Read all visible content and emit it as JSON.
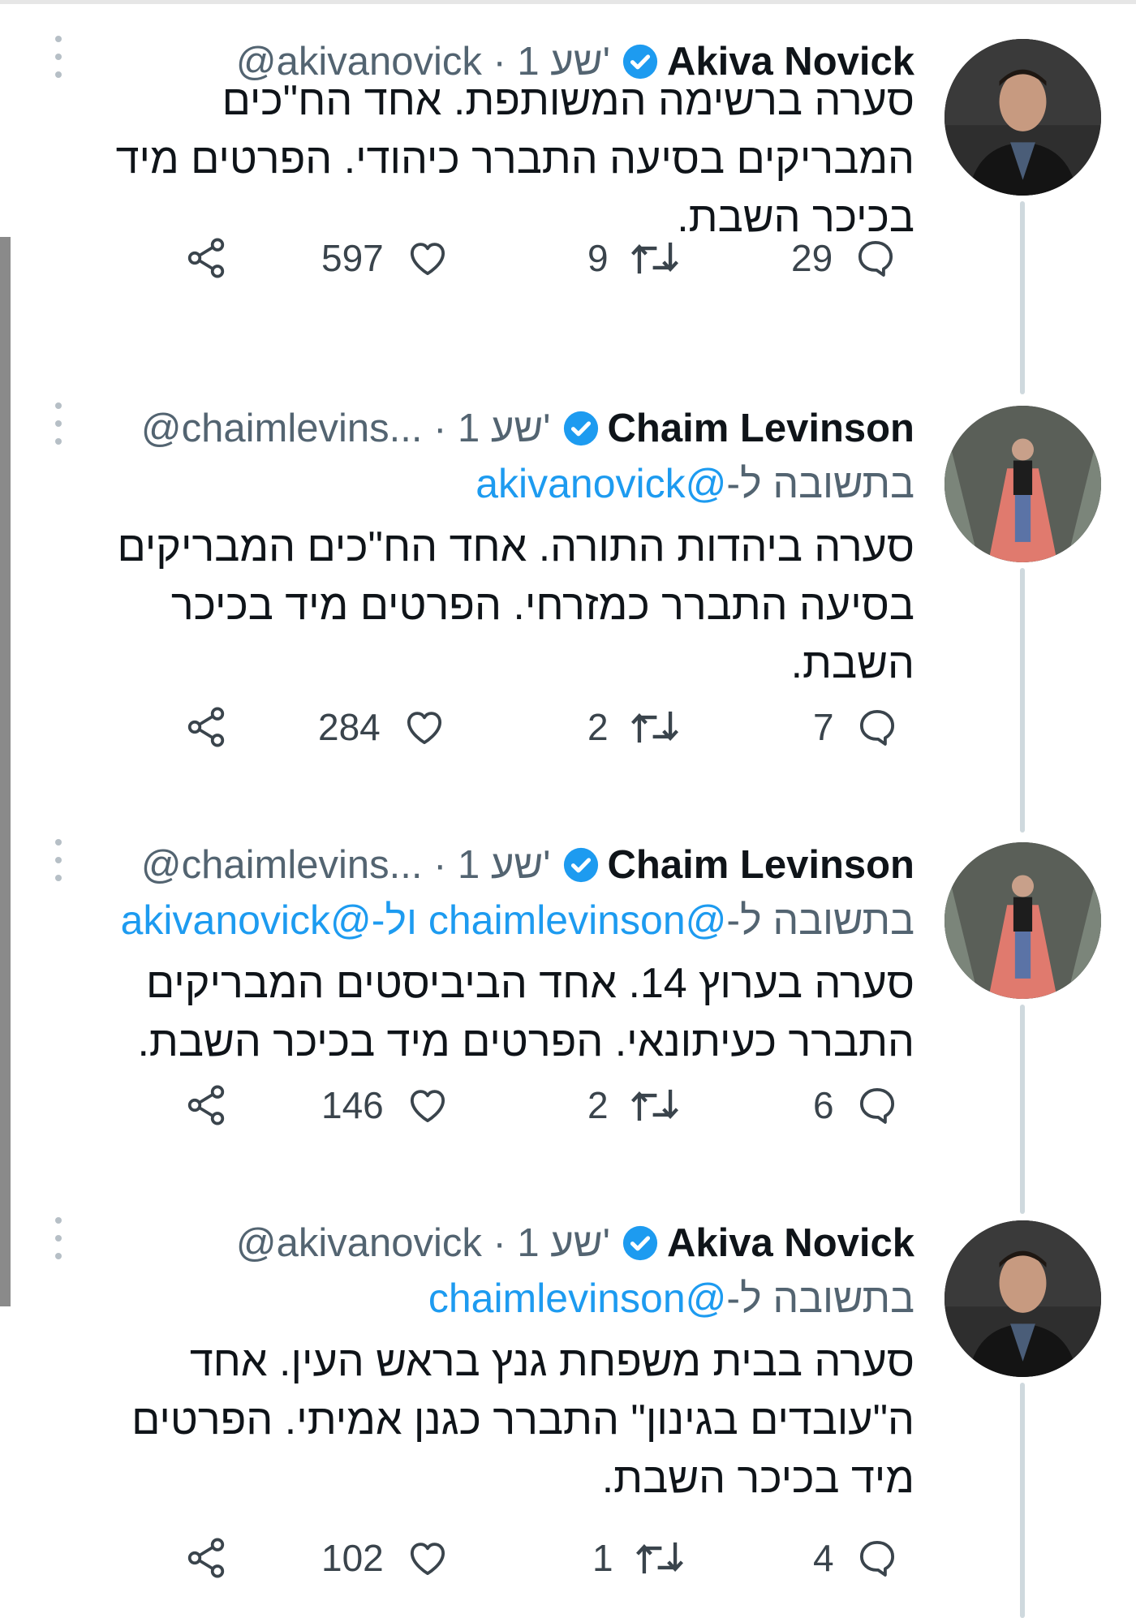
{
  "tweets": [
    {
      "name": "Akiva Novick",
      "handle_time": "@akivanovick · 1 שע'",
      "reply_prefix": "",
      "reply_mentions": "",
      "text": "סערה ברשימה המשותפת. אחד הח\"כים המבריקים בסיעה התברר כיהודי. הפרטים מיד בכיכר השבת.",
      "stats": {
        "replies": "29",
        "retweets": "9",
        "likes": "597"
      }
    },
    {
      "name": "Chaim Levinson",
      "handle_time": "@chaimlevins... · 1 שע'",
      "reply_prefix": "בתשובה ל-",
      "reply_mentions": "@akivanovick",
      "text": "סערה ביהדות התורה. אחד הח\"כים המבריקים בסיעה התברר כמזרחי. הפרטים מיד בכיכר השבת.",
      "stats": {
        "replies": "7",
        "retweets": "2",
        "likes": "284"
      }
    },
    {
      "name": "Chaim Levinson",
      "handle_time": "@chaimlevins... · 1 שע'",
      "reply_prefix": "בתשובה ל-",
      "reply_mentions": "@chaimlevinson ול-@akivanovick",
      "text": "סערה בערוץ 14. אחד הביביסטים המבריקים התברר כעיתונאי. הפרטים מיד בכיכר השבת.",
      "stats": {
        "replies": "6",
        "retweets": "2",
        "likes": "146"
      }
    },
    {
      "name": "Akiva Novick",
      "handle_time": "@akivanovick · 1 שע'",
      "reply_prefix": "בתשובה ל-",
      "reply_mentions": "@chaimlevinson",
      "text": "סערה בבית משפחת גנץ בראש העין. אחד ה\"עובדים בגינון\" התברר כגנן אמיתי. הפרטים מיד בכיכר השבת.",
      "stats": {
        "replies": "4",
        "retweets": "1",
        "likes": "102"
      }
    }
  ],
  "icons": {
    "more": "more-vertical-icon",
    "verified": "verified-badge-icon",
    "reply": "reply-bubble-icon",
    "retweet": "retweet-icon",
    "like": "heart-icon",
    "share": "share-icon"
  },
  "colors": {
    "verified": "#1d9bf0",
    "mention": "#1d9bf0",
    "secondary_text": "#536471",
    "thread_line": "#cfd9de"
  }
}
